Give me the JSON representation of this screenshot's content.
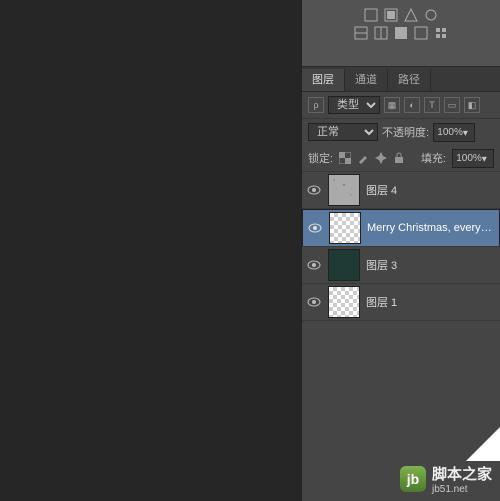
{
  "tabs": {
    "layers": "图层",
    "channels": "通道",
    "paths": "路径"
  },
  "filter": {
    "label": "类型",
    "search_text": "ρ"
  },
  "blend": {
    "mode": "正常",
    "opacity_label": "不透明度:",
    "opacity": "100%",
    "lock_label": "锁定:",
    "fill_label": "填充:",
    "fill": "100%"
  },
  "layers": [
    {
      "name": "图层 4",
      "thumb": "noise",
      "selected": false
    },
    {
      "name": "Merry Christmas, everyo…",
      "thumb": "trans",
      "selected": true
    },
    {
      "name": "图层 3",
      "thumb": "dark",
      "selected": false
    },
    {
      "name": "图层 1",
      "thumb": "trans",
      "selected": false
    }
  ],
  "watermark": {
    "site": "jb51.net",
    "brand": "脚本之家"
  }
}
